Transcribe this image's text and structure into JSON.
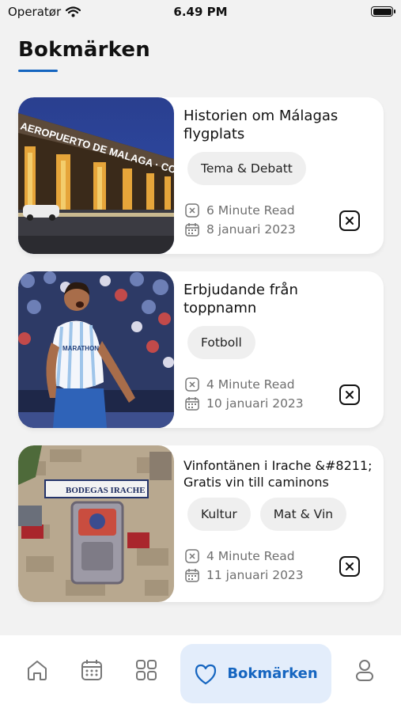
{
  "status_bar": {
    "carrier": "Operatør",
    "time": "6.49 PM"
  },
  "page_title": "Bokmärken",
  "accent_color": "#1565c0",
  "bookmarks": [
    {
      "title": "Historien om Málagas flygplats",
      "tags": [
        "Tema & Debatt"
      ],
      "read_time": "6 Minute Read",
      "date": "8 januari 2023",
      "image_text": "AEROPUERTO DE MALAGA · COSTA DEL SOL"
    },
    {
      "title": "Erbjudande från toppnamn",
      "tags": [
        "Fotboll"
      ],
      "read_time": "4 Minute Read",
      "date": "10 januari 2023",
      "image_text": "MARATHON"
    },
    {
      "title": "Vinfontänen i Irache &#8211; Gratis vin till caminons",
      "tags": [
        "Kultur",
        "Mat & Vin"
      ],
      "read_time": "4 Minute Read",
      "date": "11 januari 2023",
      "image_text": "BODEGAS IRACHE"
    }
  ],
  "tab_bar": {
    "items": [
      {
        "icon": "home-icon"
      },
      {
        "icon": "calendar-icon"
      },
      {
        "icon": "grid-icon"
      },
      {
        "icon": "heart-icon",
        "label": "Bokmärken",
        "active": true
      },
      {
        "icon": "profile-icon"
      }
    ]
  }
}
